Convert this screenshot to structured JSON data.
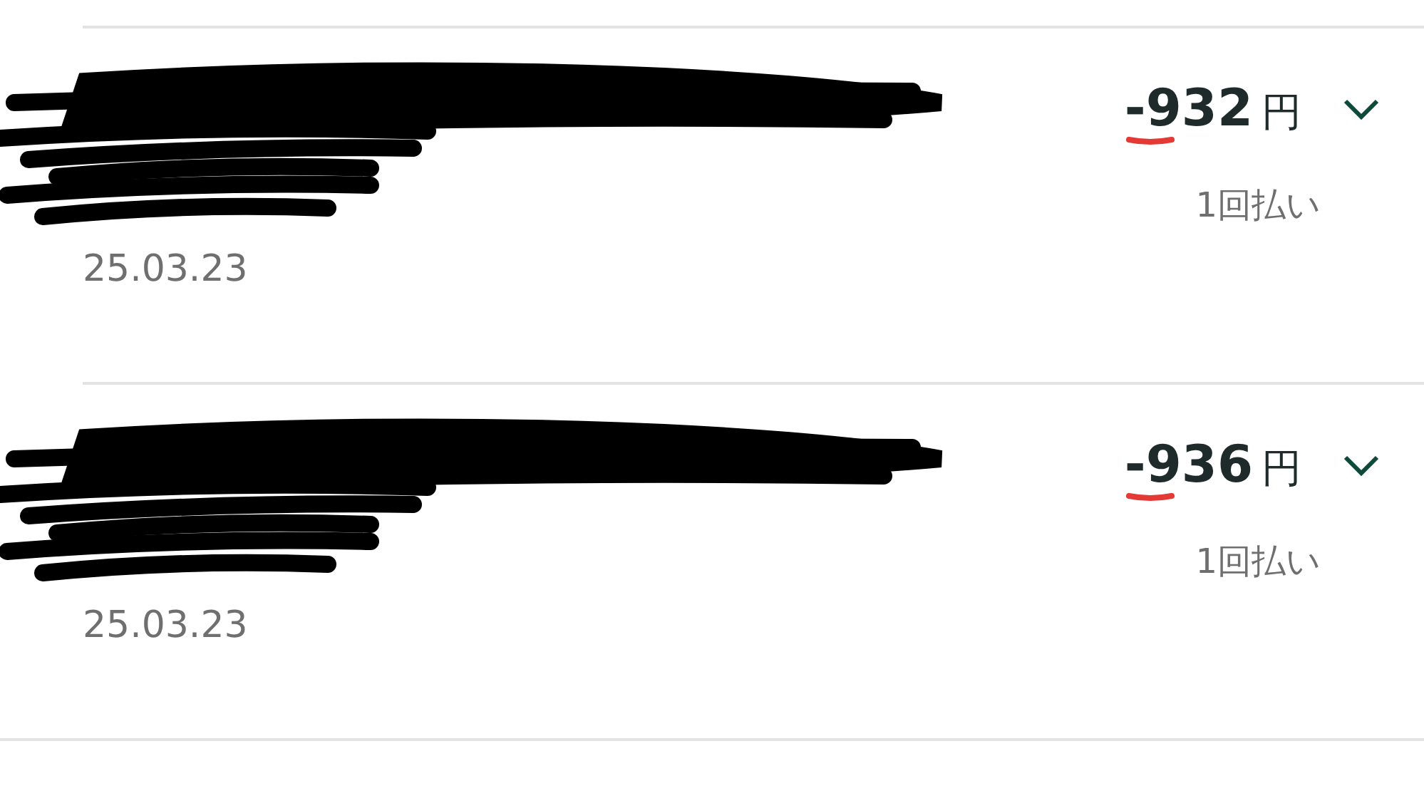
{
  "transactions": [
    {
      "amount": "-932",
      "currency": "円",
      "payment": "1回払い",
      "date": "25.03.23",
      "expanded": false
    },
    {
      "amount": "-936",
      "currency": "円",
      "payment": "1回払い",
      "date": "25.03.23",
      "expanded": false
    }
  ]
}
